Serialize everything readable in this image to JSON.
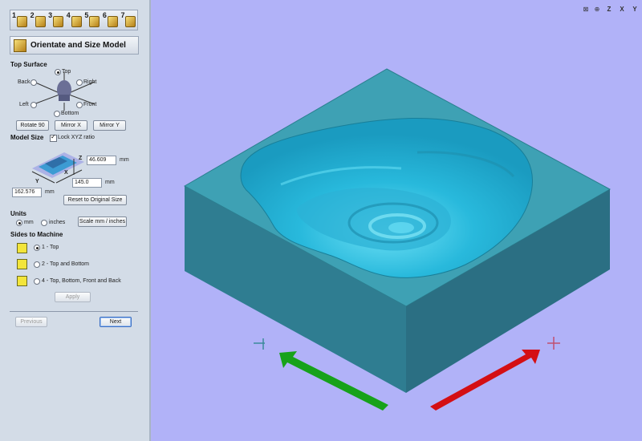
{
  "wizard": {
    "steps": [
      {
        "num": "1"
      },
      {
        "num": "2"
      },
      {
        "num": "3"
      },
      {
        "num": "4"
      },
      {
        "num": "5"
      },
      {
        "num": "6"
      },
      {
        "num": "7"
      }
    ],
    "title": "Orientate and Size Model"
  },
  "top_surface": {
    "heading": "Top Surface",
    "options": {
      "top": "Top",
      "back": "Back",
      "right": "Right",
      "left": "Left",
      "front": "Front",
      "bottom": "Bottom"
    },
    "selected": "top",
    "rotate_label": "Rotate 90",
    "mirror_x_label": "Mirror X",
    "mirror_y_label": "Mirror Y"
  },
  "model_size": {
    "heading": "Model Size",
    "lock_label": "Lock XYZ ratio",
    "lock_checked": true,
    "z_label": "Z",
    "x_label": "X",
    "y_label": "Y",
    "z_value": "46.609",
    "x_value": "145.0",
    "y_value": "162.576",
    "unit_z": "mm",
    "unit_x": "mm",
    "unit_y": "mm",
    "reset_label": "Reset to Original Size"
  },
  "units": {
    "heading": "Units",
    "mm_label": "mm",
    "inches_label": "inches",
    "selected": "mm",
    "scale_label": "Scale mm / inches"
  },
  "sides": {
    "heading": "Sides to Machine",
    "options": [
      "1 - Top",
      "2 - Top and Bottom",
      "4 - Top, Bottom, Front and Back"
    ],
    "selected_index": 0,
    "apply_label": "Apply"
  },
  "nav": {
    "previous_label": "Previous",
    "next_label": "Next"
  },
  "viewport_toolbar": {
    "z_label": "Z",
    "x_label": "X",
    "y_label": "Y"
  },
  "colors": {
    "panel_bg": "#d3dce7",
    "viewport_bg": "#b1b2f8",
    "model_top": "#3ea1b4",
    "model_relief": "#2ec3e6",
    "arrow_x": "#d40f14",
    "arrow_y": "#17a21a"
  }
}
